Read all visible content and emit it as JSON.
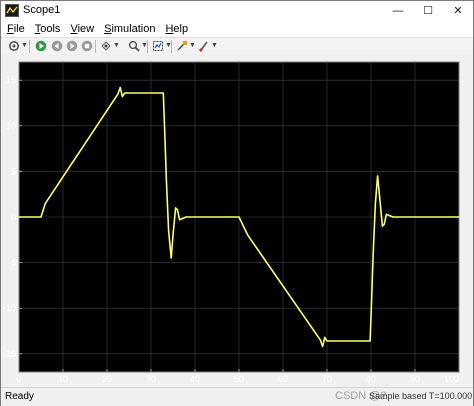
{
  "window": {
    "title": "Scope1",
    "controls": {
      "minimize": "—",
      "maximize": "☐",
      "close": "✕"
    }
  },
  "menu": {
    "items": [
      "File",
      "Tools",
      "View",
      "Simulation",
      "Help"
    ]
  },
  "toolbar": {
    "icons": [
      "settings-icon",
      "play-icon",
      "step-back-icon",
      "step-forward-icon",
      "stop-icon",
      "highlight-icon",
      "zoom-icon",
      "autoscale-icon",
      "cursor-measure-icon",
      "style-icon"
    ]
  },
  "status": {
    "left": "Ready",
    "right": "Sample based  T=100.000",
    "watermark": "CSDN @2"
  },
  "colors": {
    "plot_background": "#000000",
    "grid": "#444444",
    "signal": "#ffff66",
    "tick_text": "#ffffff"
  },
  "chart_data": {
    "type": "line",
    "title": "",
    "xlabel": "",
    "ylabel": "",
    "xlim": [
      0,
      100
    ],
    "ylim": [
      -17,
      17
    ],
    "xticks": [
      0,
      10,
      20,
      30,
      40,
      50,
      60,
      70,
      80,
      90,
      100
    ],
    "yticks": [
      15,
      10,
      5,
      0,
      -5,
      -10,
      -15
    ],
    "grid": true,
    "series": [
      {
        "x": [
          0,
          5,
          6,
          22.5,
          23,
          23.5,
          24,
          32.8,
          33,
          33.5,
          34,
          34.6,
          35,
          35.6,
          36,
          36.5,
          37,
          38,
          39,
          50,
          51,
          52,
          68.5,
          69,
          69.5,
          70,
          79.8,
          80,
          80.5,
          81,
          81.5,
          82,
          82.6,
          83,
          83.5,
          84,
          85,
          86,
          100
        ],
        "y": [
          0,
          0,
          1.5,
          13.5,
          14.2,
          13.2,
          13.6,
          13.6,
          11,
          4,
          -1.5,
          -4.5,
          -2,
          1,
          0.8,
          -0.3,
          -0.2,
          0,
          0,
          0,
          -1,
          -2,
          -13.5,
          -14.2,
          -13.2,
          -13.6,
          -13.6,
          -11,
          -4,
          1.5,
          4.5,
          2,
          -1,
          -0.8,
          0.3,
          0.2,
          0,
          0,
          0
        ]
      }
    ]
  }
}
